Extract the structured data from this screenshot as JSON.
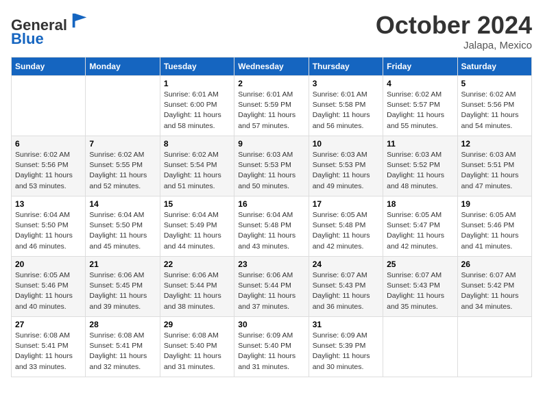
{
  "header": {
    "logo_line1": "General",
    "logo_line2": "Blue",
    "month": "October 2024",
    "location": "Jalapa, Mexico"
  },
  "days_of_week": [
    "Sunday",
    "Monday",
    "Tuesday",
    "Wednesday",
    "Thursday",
    "Friday",
    "Saturday"
  ],
  "weeks": [
    [
      {
        "day": "",
        "info": ""
      },
      {
        "day": "",
        "info": ""
      },
      {
        "day": "1",
        "info": "Sunrise: 6:01 AM\nSunset: 6:00 PM\nDaylight: 11 hours and 58 minutes."
      },
      {
        "day": "2",
        "info": "Sunrise: 6:01 AM\nSunset: 5:59 PM\nDaylight: 11 hours and 57 minutes."
      },
      {
        "day": "3",
        "info": "Sunrise: 6:01 AM\nSunset: 5:58 PM\nDaylight: 11 hours and 56 minutes."
      },
      {
        "day": "4",
        "info": "Sunrise: 6:02 AM\nSunset: 5:57 PM\nDaylight: 11 hours and 55 minutes."
      },
      {
        "day": "5",
        "info": "Sunrise: 6:02 AM\nSunset: 5:56 PM\nDaylight: 11 hours and 54 minutes."
      }
    ],
    [
      {
        "day": "6",
        "info": "Sunrise: 6:02 AM\nSunset: 5:56 PM\nDaylight: 11 hours and 53 minutes."
      },
      {
        "day": "7",
        "info": "Sunrise: 6:02 AM\nSunset: 5:55 PM\nDaylight: 11 hours and 52 minutes."
      },
      {
        "day": "8",
        "info": "Sunrise: 6:02 AM\nSunset: 5:54 PM\nDaylight: 11 hours and 51 minutes."
      },
      {
        "day": "9",
        "info": "Sunrise: 6:03 AM\nSunset: 5:53 PM\nDaylight: 11 hours and 50 minutes."
      },
      {
        "day": "10",
        "info": "Sunrise: 6:03 AM\nSunset: 5:53 PM\nDaylight: 11 hours and 49 minutes."
      },
      {
        "day": "11",
        "info": "Sunrise: 6:03 AM\nSunset: 5:52 PM\nDaylight: 11 hours and 48 minutes."
      },
      {
        "day": "12",
        "info": "Sunrise: 6:03 AM\nSunset: 5:51 PM\nDaylight: 11 hours and 47 minutes."
      }
    ],
    [
      {
        "day": "13",
        "info": "Sunrise: 6:04 AM\nSunset: 5:50 PM\nDaylight: 11 hours and 46 minutes."
      },
      {
        "day": "14",
        "info": "Sunrise: 6:04 AM\nSunset: 5:50 PM\nDaylight: 11 hours and 45 minutes."
      },
      {
        "day": "15",
        "info": "Sunrise: 6:04 AM\nSunset: 5:49 PM\nDaylight: 11 hours and 44 minutes."
      },
      {
        "day": "16",
        "info": "Sunrise: 6:04 AM\nSunset: 5:48 PM\nDaylight: 11 hours and 43 minutes."
      },
      {
        "day": "17",
        "info": "Sunrise: 6:05 AM\nSunset: 5:48 PM\nDaylight: 11 hours and 42 minutes."
      },
      {
        "day": "18",
        "info": "Sunrise: 6:05 AM\nSunset: 5:47 PM\nDaylight: 11 hours and 42 minutes."
      },
      {
        "day": "19",
        "info": "Sunrise: 6:05 AM\nSunset: 5:46 PM\nDaylight: 11 hours and 41 minutes."
      }
    ],
    [
      {
        "day": "20",
        "info": "Sunrise: 6:05 AM\nSunset: 5:46 PM\nDaylight: 11 hours and 40 minutes."
      },
      {
        "day": "21",
        "info": "Sunrise: 6:06 AM\nSunset: 5:45 PM\nDaylight: 11 hours and 39 minutes."
      },
      {
        "day": "22",
        "info": "Sunrise: 6:06 AM\nSunset: 5:44 PM\nDaylight: 11 hours and 38 minutes."
      },
      {
        "day": "23",
        "info": "Sunrise: 6:06 AM\nSunset: 5:44 PM\nDaylight: 11 hours and 37 minutes."
      },
      {
        "day": "24",
        "info": "Sunrise: 6:07 AM\nSunset: 5:43 PM\nDaylight: 11 hours and 36 minutes."
      },
      {
        "day": "25",
        "info": "Sunrise: 6:07 AM\nSunset: 5:43 PM\nDaylight: 11 hours and 35 minutes."
      },
      {
        "day": "26",
        "info": "Sunrise: 6:07 AM\nSunset: 5:42 PM\nDaylight: 11 hours and 34 minutes."
      }
    ],
    [
      {
        "day": "27",
        "info": "Sunrise: 6:08 AM\nSunset: 5:41 PM\nDaylight: 11 hours and 33 minutes."
      },
      {
        "day": "28",
        "info": "Sunrise: 6:08 AM\nSunset: 5:41 PM\nDaylight: 11 hours and 32 minutes."
      },
      {
        "day": "29",
        "info": "Sunrise: 6:08 AM\nSunset: 5:40 PM\nDaylight: 11 hours and 31 minutes."
      },
      {
        "day": "30",
        "info": "Sunrise: 6:09 AM\nSunset: 5:40 PM\nDaylight: 11 hours and 31 minutes."
      },
      {
        "day": "31",
        "info": "Sunrise: 6:09 AM\nSunset: 5:39 PM\nDaylight: 11 hours and 30 minutes."
      },
      {
        "day": "",
        "info": ""
      },
      {
        "day": "",
        "info": ""
      }
    ]
  ]
}
